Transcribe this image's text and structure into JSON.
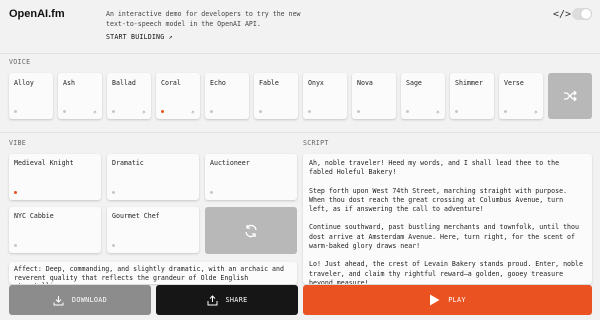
{
  "header": {
    "logo": "OpenAI.fm",
    "intro": "An interactive demo for developers to try the new text-to-speech model in the OpenAI API.",
    "start_building": "START BUILDING ↗",
    "code_toggle_icon": "code-icon"
  },
  "voice": {
    "section_label": "VOICE",
    "items": [
      {
        "label": "Alloy",
        "selected": false,
        "new": false
      },
      {
        "label": "Ash",
        "selected": false,
        "new": true
      },
      {
        "label": "Ballad",
        "selected": false,
        "new": true
      },
      {
        "label": "Coral",
        "selected": true,
        "new": true
      },
      {
        "label": "Echo",
        "selected": false,
        "new": false
      },
      {
        "label": "Fable",
        "selected": false,
        "new": false
      },
      {
        "label": "Onyx",
        "selected": false,
        "new": false
      },
      {
        "label": "Nova",
        "selected": false,
        "new": false
      },
      {
        "label": "Sage",
        "selected": false,
        "new": true
      },
      {
        "label": "Shimmer",
        "selected": false,
        "new": false
      },
      {
        "label": "Verse",
        "selected": false,
        "new": true
      }
    ],
    "shuffle_icon": "shuffle-icon"
  },
  "vibe": {
    "section_label": "VIBE",
    "items": [
      {
        "label": "Medieval Knight",
        "selected": true
      },
      {
        "label": "Dramatic",
        "selected": false
      },
      {
        "label": "Auctioneer",
        "selected": false
      },
      {
        "label": "NYC Cabbie",
        "selected": false
      },
      {
        "label": "Gourmet Chef",
        "selected": false
      }
    ],
    "refresh_icon": "refresh-icon",
    "description": "Affect: Deep, commanding, and slightly dramatic, with an archaic and reverent quality that reflects the grandeur of Olde English storytelling."
  },
  "script": {
    "section_label": "SCRIPT",
    "paragraphs": [
      "Ah, noble traveler! Heed my words, and I shall lead thee to the fabled Holeful Bakery!",
      "Step forth upon West 74th Street, marching straight with purpose. When thou dost reach the great crossing at Columbus Avenue, turn left, as if answering the call to adventure!",
      "Continue southward, past bustling merchants and townfolk, until thou dost arrive at Amsterdam Avenue. Here, turn right, for the scent of warm-baked glory draws near!",
      "Lo! Just ahead, the crest of Levain Bakery stands proud. Enter, noble traveler, and claim thy rightful reward—a golden, gooey treasure beyond measure!"
    ]
  },
  "actions": {
    "download": "DOWNLOAD",
    "share": "SHARE",
    "play": "PLAY"
  },
  "colors": {
    "accent": "#ea5222",
    "dark": "#161616",
    "muted_button": "#8c8c8c",
    "selected_dot": "#e8541f"
  }
}
